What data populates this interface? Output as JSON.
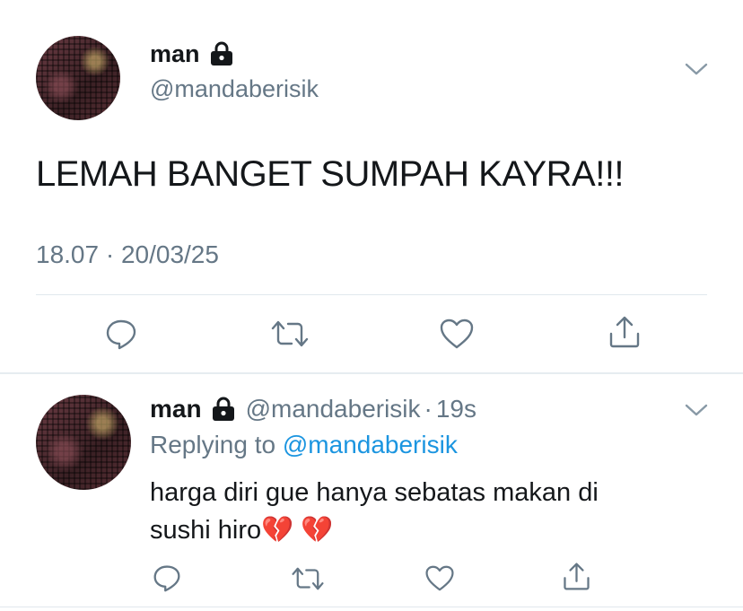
{
  "main_tweet": {
    "name": "man",
    "handle": "@mandaberisik",
    "text": "LEMAH BANGET SUMPAH KAYRA!!!",
    "timestamp": "18.07 · 20/03/25"
  },
  "reply_tweet": {
    "name": "man",
    "handle": "@mandaberisik",
    "separator": "·",
    "time_ago": "19s",
    "replying_prefix": "Replying to ",
    "replying_to": "@mandaberisik",
    "text_line1": "harga diri gue hanya sebatas makan di",
    "text_line2": "sushi hiro💔 💔"
  },
  "icons": {
    "verified_lock": "lock-icon",
    "menu": "chevron-down-icon",
    "reply": "reply-icon",
    "retweet": "retweet-icon",
    "like": "heart-icon",
    "share": "share-icon"
  },
  "colors": {
    "text": "#14171a",
    "muted": "#657786",
    "link": "#1b95e0",
    "divider": "#e1e8ed"
  }
}
